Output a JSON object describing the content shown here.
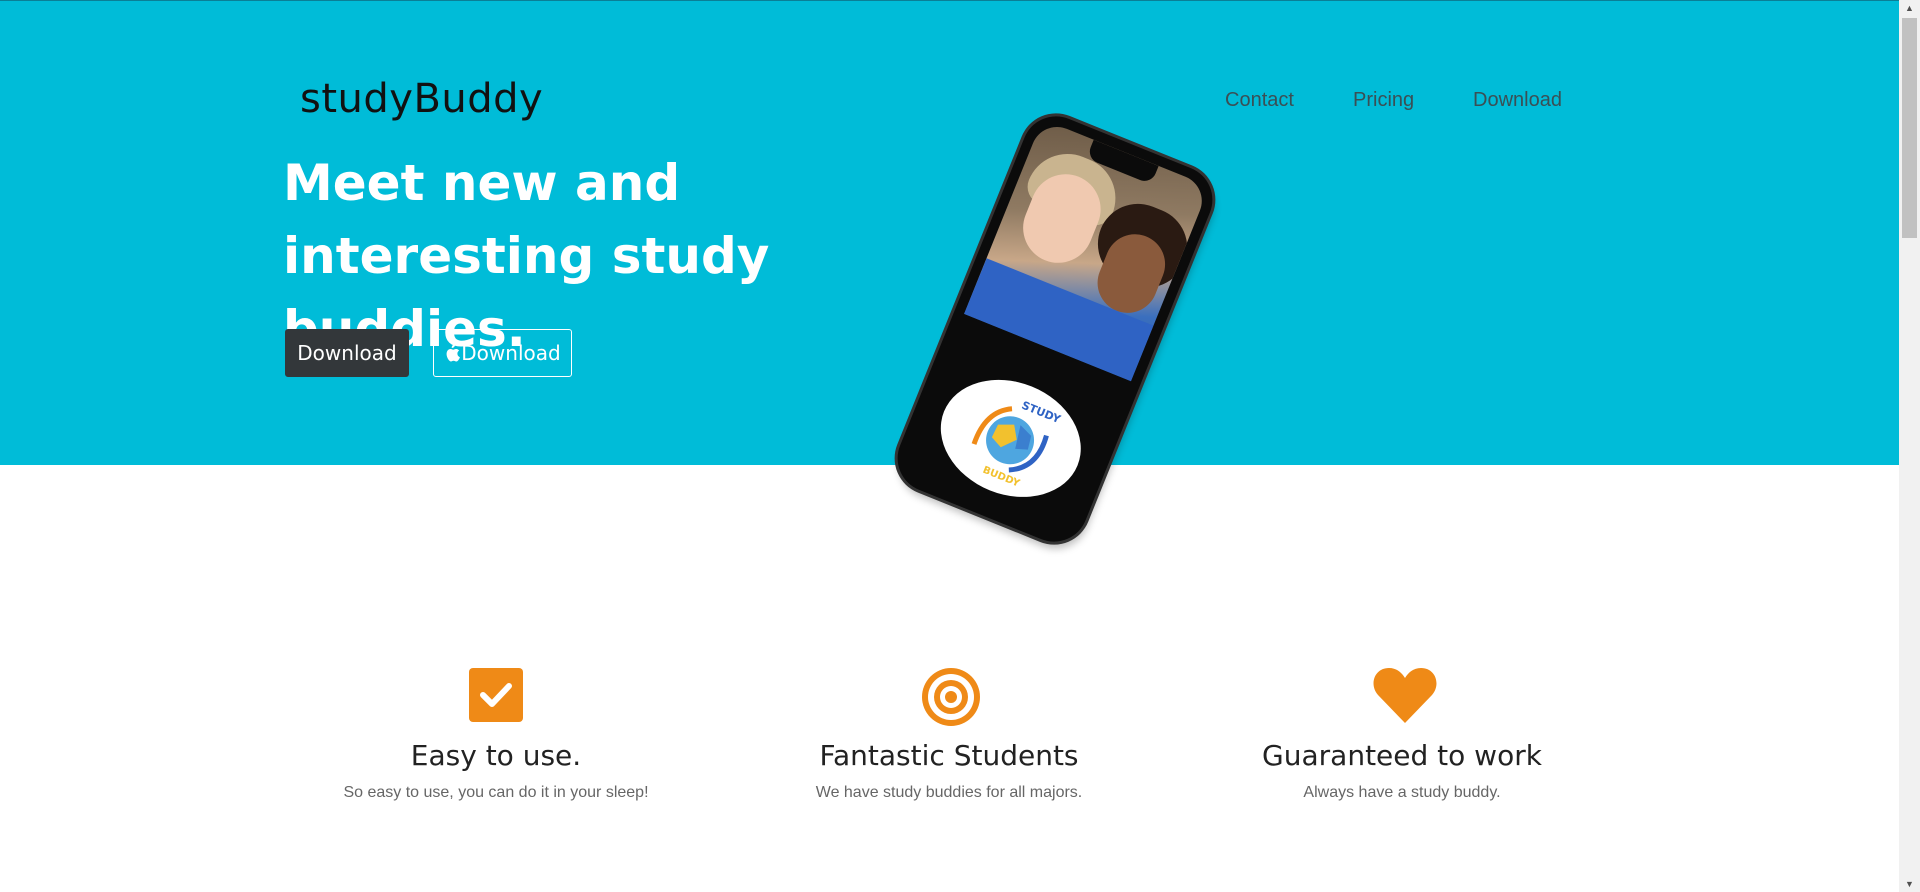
{
  "brand": "studyBuddy",
  "nav": {
    "items": [
      "Contact",
      "Pricing",
      "Download"
    ]
  },
  "hero": {
    "headline": "Meet new and interesting study buddies.",
    "download_label": "Download",
    "apple_download_label": "Download",
    "phone_logo_text_top": "STUDY",
    "phone_logo_text_bottom": "BUDDY",
    "background_color": "#00bcd8"
  },
  "features": [
    {
      "icon": "checkbox-icon",
      "title": "Easy to use.",
      "subtitle": "So easy to use, you can do it in your sleep!"
    },
    {
      "icon": "target-icon",
      "title": "Fantastic Students",
      "subtitle": "We have study buddies for all majors."
    },
    {
      "icon": "heart-icon",
      "title": "Guaranteed to work",
      "subtitle": "Always have a study buddy."
    }
  ],
  "colors": {
    "accent": "#ef8a17",
    "dark_button": "#33373a"
  }
}
